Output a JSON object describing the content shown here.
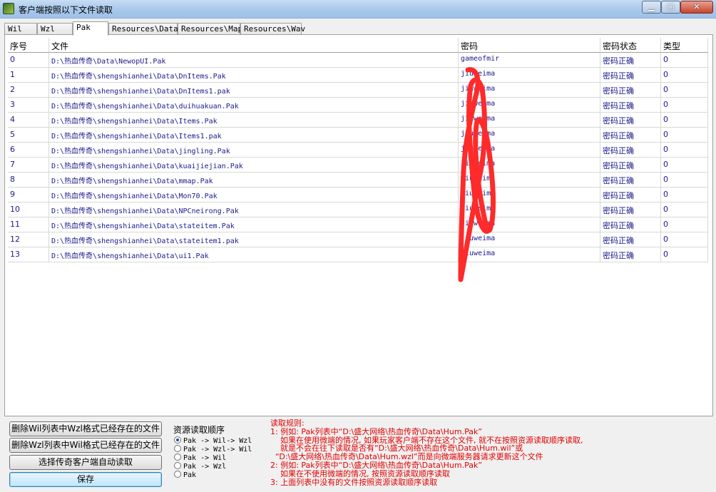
{
  "window": {
    "title": "客户端按照以下文件读取",
    "min_glyph": "▁",
    "max_glyph": "▢",
    "close_glyph": "✕"
  },
  "tabs": [
    {
      "label": "Wil",
      "active": false
    },
    {
      "label": "Wzl",
      "active": false
    },
    {
      "label": "Pak",
      "active": true
    },
    {
      "label": "Resources\\Data",
      "active": false
    },
    {
      "label": "Resources\\Map",
      "active": false
    },
    {
      "label": "Resources\\Wav",
      "active": false
    }
  ],
  "table": {
    "headers": [
      "序号",
      "文件",
      "密码",
      "密码状态",
      "类型"
    ],
    "rows": [
      [
        "0",
        "D:\\热血传奇\\Data\\NewopUI.Pak",
        "gameofmir",
        "密码正确",
        "0"
      ],
      [
        "1",
        "D:\\热血传奇\\shengshianhei\\Data\\DnItems.Pak",
        "jiuweima",
        "密码正确",
        "0"
      ],
      [
        "2",
        "D:\\热血传奇\\shengshianhei\\Data\\DnItems1.pak",
        "jiuweima",
        "密码正确",
        "0"
      ],
      [
        "3",
        "D:\\热血传奇\\shengshianhei\\Data\\duihuakuan.Pak",
        "jiuweima",
        "密码正确",
        "0"
      ],
      [
        "4",
        "D:\\热血传奇\\shengshianhei\\Data\\Items.Pak",
        "jiuweima",
        "密码正确",
        "0"
      ],
      [
        "5",
        "D:\\热血传奇\\shengshianhei\\Data\\Items1.pak",
        "jiuweima",
        "密码正确",
        "0"
      ],
      [
        "6",
        "D:\\热血传奇\\shengshianhei\\Data\\jingling.Pak",
        "jiuweima",
        "密码正确",
        "0"
      ],
      [
        "7",
        "D:\\热血传奇\\shengshianhei\\Data\\kuaijiejian.Pak",
        "jiuweima",
        "密码正确",
        "0"
      ],
      [
        "8",
        "D:\\热血传奇\\shengshianhei\\Data\\mmap.Pak",
        "jiuweima",
        "密码正确",
        "0"
      ],
      [
        "9",
        "D:\\热血传奇\\shengshianhei\\Data\\Mon70.Pak",
        "jiuweima",
        "密码正确",
        "0"
      ],
      [
        "10",
        "D:\\热血传奇\\shengshianhei\\Data\\NPCneirong.Pak",
        "jiuweima",
        "密码正确",
        "0"
      ],
      [
        "11",
        "D:\\热血传奇\\shengshianhei\\Data\\stateitem.Pak",
        "jiuweima",
        "密码正确",
        "0"
      ],
      [
        "12",
        "D:\\热血传奇\\shengshianhei\\Data\\stateitem1.pak",
        "jiuweima",
        "密码正确",
        "0"
      ],
      [
        "13",
        "D:\\热血传奇\\shengshianhei\\Data\\ui1.Pak",
        "jiuweima",
        "密码正确",
        "0"
      ]
    ]
  },
  "buttons": {
    "delete_wil": "删除Wil列表中Wzl格式已经存在的文件",
    "delete_wzl": "删除Wzl列表中Wil格式已经存在的文件",
    "auto_read": "选择传奇客户端自动读取",
    "save": "保存"
  },
  "resource_order": {
    "title": "资源读取顺序",
    "options": [
      {
        "label": "Pak -> Wil-> Wzl",
        "selected": true
      },
      {
        "label": "Pak -> Wzl-> Wil",
        "selected": false
      },
      {
        "label": "Pak -> Wil",
        "selected": false
      },
      {
        "label": "Pak -> Wzl",
        "selected": false
      },
      {
        "label": "Pak",
        "selected": false
      }
    ]
  },
  "rules": [
    "读取规则:",
    "1: 例如: Pak列表中“D:\\盛大网络\\热血传奇\\Data\\Hum.Pak”",
    "    如果在使用微端的情况, 如果玩家客户端不存在这个文件, 就不在按照资源读取顺序读取,",
    "    就是不会在往下读取是否有“D:\\盛大网络\\热血传奇\\Data\\Hum.wil”或",
    "  “D:\\盛大网络\\热血传奇\\Data\\Hum.wzl”而是向微端服务器请求更新这个文件",
    "2: 例如: Pak列表中“D:\\盛大网络\\热血传奇\\Data\\Hum.Pak”",
    "    如果在不使用微端的情况, 按照资源读取顺序读取",
    "3: 上面列表中没有的文件按照资源读取顺序读取"
  ],
  "colors": {
    "annotation_stroke": "#ff2a2a"
  }
}
